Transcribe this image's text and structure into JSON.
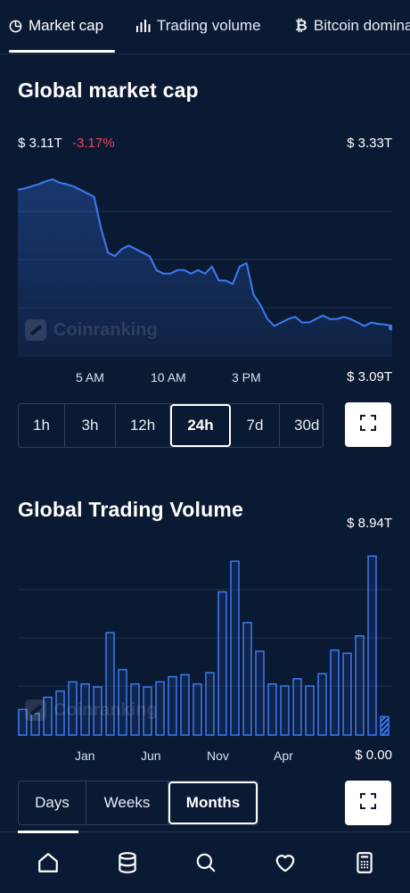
{
  "tabs": [
    {
      "label": "Market cap",
      "icon": "pie-chart-icon",
      "active": true
    },
    {
      "label": "Trading volume",
      "icon": "bar-chart-icon",
      "active": false
    },
    {
      "label": "Bitcoin dominance",
      "icon": "bitcoin-icon",
      "active": false
    }
  ],
  "market_cap": {
    "title": "Global market cap",
    "current_value": "$ 3.11T",
    "change": "-3.17%",
    "high_label": "$ 3.33T",
    "low_label": "$ 3.09T",
    "watermark": "Coinranking",
    "x_labels": [
      "5 AM",
      "10 AM",
      "3 PM"
    ],
    "periods": [
      "1h",
      "3h",
      "12h",
      "24h",
      "7d",
      "30d"
    ],
    "selected_period": "24h"
  },
  "trading_volume": {
    "title": "Global Trading Volume",
    "high_label": "$ 8.94T",
    "low_label": "$ 0.00",
    "watermark": "Coinranking",
    "x_labels": [
      "Jan",
      "Jun",
      "Nov",
      "Apr"
    ],
    "ranges": [
      "Days",
      "Weeks",
      "Months"
    ],
    "selected_range": "Months"
  },
  "colors": {
    "background": "#0b1a33",
    "line": "#3a7bf5",
    "negative": "#f0405a"
  },
  "chart_data": [
    {
      "type": "area",
      "title": "Global market cap",
      "ylim": [
        3.09,
        3.33
      ],
      "x_labels": [
        "5 AM",
        "10 AM",
        "3 PM"
      ],
      "values": [
        3.31,
        3.312,
        3.315,
        3.318,
        3.322,
        3.325,
        3.32,
        3.318,
        3.315,
        3.31,
        3.305,
        3.3,
        3.255,
        3.22,
        3.215,
        3.225,
        3.23,
        3.225,
        3.22,
        3.215,
        3.195,
        3.19,
        3.19,
        3.195,
        3.195,
        3.19,
        3.195,
        3.19,
        3.2,
        3.18,
        3.18,
        3.175,
        3.2,
        3.205,
        3.16,
        3.145,
        3.125,
        3.115,
        3.12,
        3.125,
        3.128,
        3.12,
        3.12,
        3.125,
        3.13,
        3.125,
        3.125,
        3.128,
        3.125,
        3.12,
        3.115,
        3.12,
        3.118,
        3.117,
        3.115
      ],
      "grid": true
    },
    {
      "type": "bar",
      "title": "Global Trading Volume",
      "ylim": [
        0,
        8.94
      ],
      "x_labels": [
        "Jan",
        "Jun",
        "Nov",
        "Apr"
      ],
      "values": [
        1.25,
        1.05,
        1.85,
        2.15,
        2.6,
        2.5,
        2.35,
        5.0,
        3.2,
        2.5,
        2.35,
        2.6,
        2.85,
        2.95,
        2.5,
        3.05,
        7.0,
        8.5,
        5.5,
        4.1,
        2.5,
        2.4,
        2.75,
        2.4,
        3.0,
        4.15,
        4.0,
        4.85,
        8.75,
        0.9
      ],
      "grid": true
    }
  ]
}
